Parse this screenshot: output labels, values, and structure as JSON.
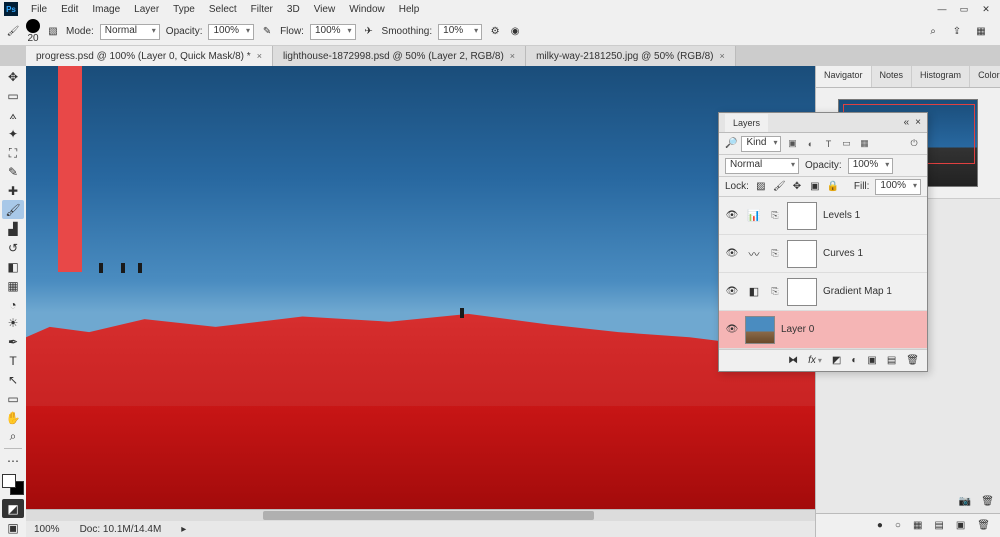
{
  "menu": {
    "items": [
      "File",
      "Edit",
      "Image",
      "Layer",
      "Type",
      "Select",
      "Filter",
      "3D",
      "View",
      "Window",
      "Help"
    ]
  },
  "window_controls": {
    "min": "—",
    "max": "▭",
    "close": "✕"
  },
  "options": {
    "brush_size": "20",
    "mode_label": "Mode:",
    "mode_value": "Normal",
    "opacity_label": "Opacity:",
    "opacity_value": "100%",
    "flow_label": "Flow:",
    "flow_value": "100%",
    "smoothing_label": "Smoothing:",
    "smoothing_value": "10%"
  },
  "tabs": [
    {
      "label": "progress.psd @ 100% (Layer 0, Quick Mask/8) *",
      "active": true
    },
    {
      "label": "lighthouse-1872998.psd @ 50% (Layer 2, RGB/8)",
      "active": false
    },
    {
      "label": "milky-way-2181250.jpg @ 50% (RGB/8)",
      "active": false
    }
  ],
  "status": {
    "zoom": "100%",
    "doc": "Doc: 10.1M/14.4M"
  },
  "right_tabs": [
    "Navigator",
    "Notes",
    "Histogram",
    "Color"
  ],
  "layers_panel": {
    "title": "Layers",
    "filter_label": "Kind",
    "blend_mode": "Normal",
    "opacity_label": "Opacity:",
    "opacity_value": "100%",
    "lock_label": "Lock:",
    "fill_label": "Fill:",
    "fill_value": "100%",
    "layers": [
      {
        "name": "Levels 1",
        "adj": "levels"
      },
      {
        "name": "Curves 1",
        "adj": "curves"
      },
      {
        "name": "Gradient Map 1",
        "adj": "gradmap"
      },
      {
        "name": "Layer 0",
        "adj": "image",
        "selected": true
      }
    ]
  },
  "search_icon": "⌕"
}
